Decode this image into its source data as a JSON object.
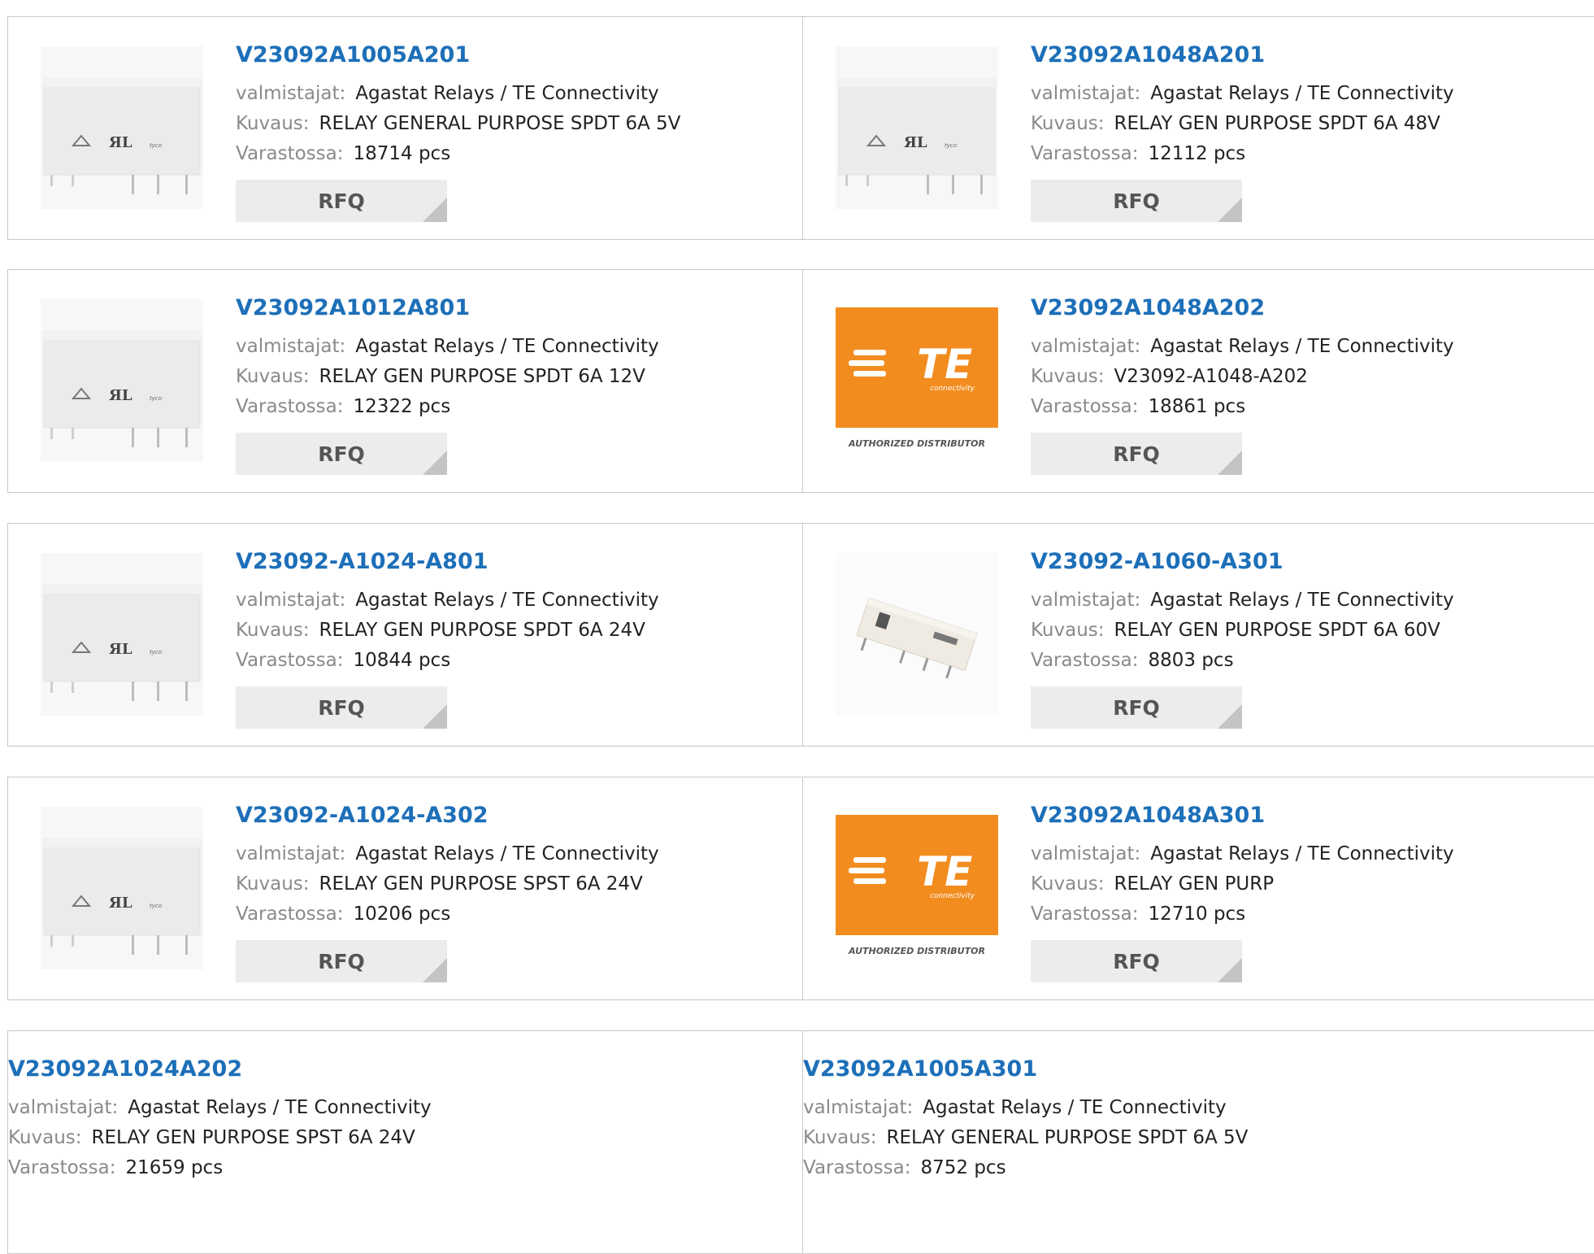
{
  "labels": {
    "manufacturer": "valmistajat:",
    "description": "Kuvaus:",
    "stock": "Varastossa:",
    "rfq": "RFQ"
  },
  "products": [
    {
      "part": "V23092A1005A201",
      "manufacturer": "Agastat Relays / TE Connectivity",
      "description": "RELAY GENERAL PURPOSE SPDT 6A 5V",
      "stock": "18714 pcs",
      "image": "relay-photo"
    },
    {
      "part": "V23092A1048A201",
      "manufacturer": "Agastat Relays / TE Connectivity",
      "description": "RELAY GEN PURPOSE SPDT 6A 48V",
      "stock": "12112 pcs",
      "image": "relay-photo"
    },
    {
      "part": "V23092A1012A801",
      "manufacturer": "Agastat Relays / TE Connectivity",
      "description": "RELAY GEN PURPOSE SPDT 6A 12V",
      "stock": "12322 pcs",
      "image": "relay-photo"
    },
    {
      "part": "V23092A1048A202",
      "manufacturer": "Agastat Relays / TE Connectivity",
      "description": "V23092-A1048-A202",
      "stock": "18861 pcs",
      "image": "te-logo",
      "logo_text": "TE",
      "logo_sub": "connectivity",
      "logo_caption": "AUTHORIZED DISTRIBUTOR"
    },
    {
      "part": "V23092-A1024-A801",
      "manufacturer": "Agastat Relays / TE Connectivity",
      "description": "RELAY GEN PURPOSE SPDT 6A 24V",
      "stock": "10844 pcs",
      "image": "relay-photo"
    },
    {
      "part": "V23092-A1060-A301",
      "manufacturer": "Agastat Relays / TE Connectivity",
      "description": "RELAY GEN PURPOSE SPDT 6A 60V",
      "stock": "8803 pcs",
      "image": "relay-angled-photo"
    },
    {
      "part": "V23092-A1024-A302",
      "manufacturer": "Agastat Relays / TE Connectivity",
      "description": "RELAY GEN PURPOSE SPST 6A 24V",
      "stock": "10206 pcs",
      "image": "relay-photo"
    },
    {
      "part": "V23092A1048A301",
      "manufacturer": "Agastat Relays / TE Connectivity",
      "description": "RELAY GEN PURP",
      "stock": "12710 pcs",
      "image": "te-logo",
      "logo_text": "TE",
      "logo_sub": "connectivity",
      "logo_caption": "AUTHORIZED DISTRIBUTOR"
    },
    {
      "part": "V23092A1024A202",
      "manufacturer": "Agastat Relays / TE Connectivity",
      "description": "RELAY GEN PURPOSE SPST 6A 24V",
      "stock": "21659 pcs",
      "image": "none"
    },
    {
      "part": "V23092A1005A301",
      "manufacturer": "Agastat Relays / TE Connectivity",
      "description": "RELAY GENERAL PURPOSE SPDT 6A 5V",
      "stock": "8752 pcs",
      "image": "none"
    }
  ],
  "colors": {
    "link": "#1d6fb8",
    "te_orange": "#f28c1f",
    "label_gray": "#8a8a8a"
  }
}
